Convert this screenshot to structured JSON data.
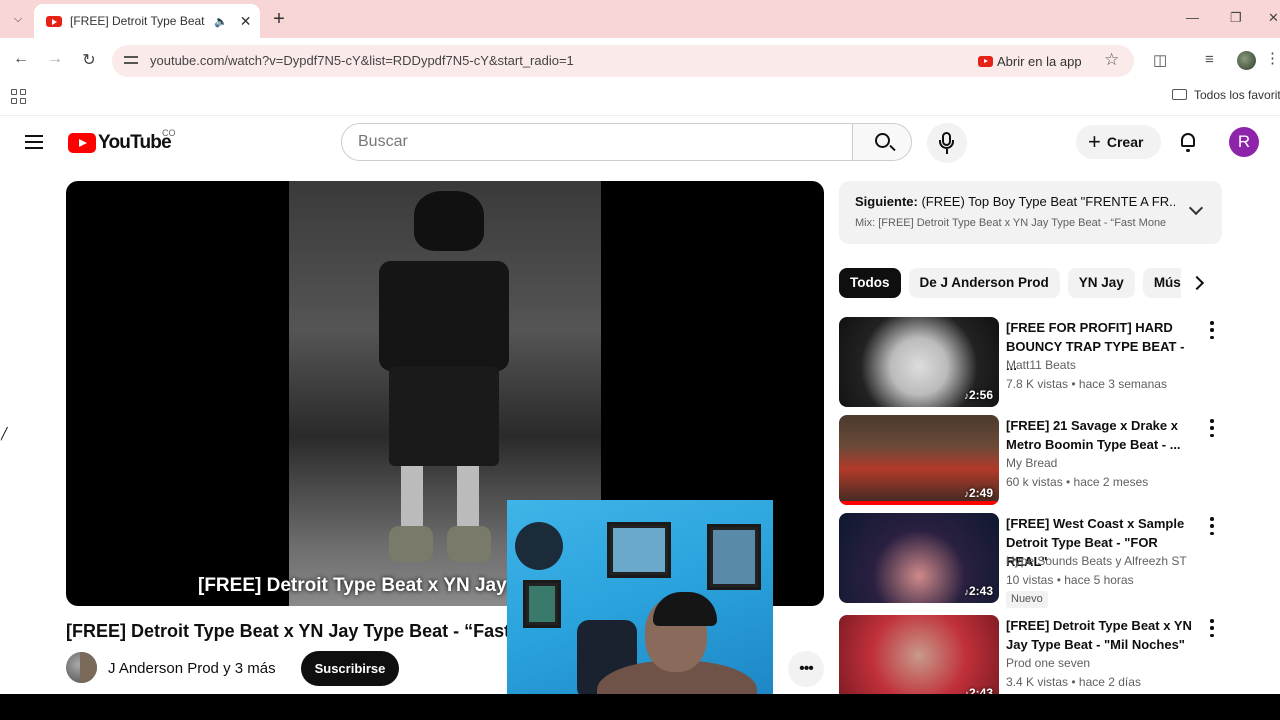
{
  "browser": {
    "tab_title": "[FREE] Detroit Type Beat x YN Jay",
    "url": "youtube.com/watch?v=Dypdf7N5-cY&list=RDDypdf7N5-cY&start_radio=1",
    "open_in_app_label": "Abrir en la app",
    "bookmarks_label": "Todos los favoritos"
  },
  "youtube": {
    "logo_text": "YouTube",
    "country_code": "CO",
    "search_placeholder": "Buscar",
    "create_label": "Crear",
    "avatar_letter": "R",
    "brand_color": "#ff0000",
    "avatar_color": "#8e24aa"
  },
  "video": {
    "caption_overlay": "[FREE] Detroit Type Beat x YN Jay Typ",
    "title": "[FREE] Detroit Type Beat x YN Jay Type Beat - “Fast",
    "channel": "J Anderson Prod y 3 más",
    "subscribe_label": "Suscribirse",
    "more_label": "•••"
  },
  "up_next": {
    "label": "Siguiente:",
    "next_title": "(FREE) Top Boy Type Beat \"FRENTE A FR...",
    "mix_title": "Mix: [FREE] Detroit Type Beat x YN Jay Type Beat - “Fast Mone"
  },
  "chips": [
    "Todos",
    "De J Anderson Prod",
    "YN Jay",
    "Músi"
  ],
  "recommendations": [
    {
      "title": "[FREE FOR PROFIT] HARD BOUNCY TRAP TYPE BEAT - ...",
      "channel": "Matt11 Beats",
      "meta": "7.8 K vistas • hace 3 semanas",
      "duration": "2:56",
      "badge": ""
    },
    {
      "title": "[FREE] 21 Savage x Drake x Metro Boomin Type Beat - ...",
      "channel": "My Bread",
      "meta": "60 k vistas • hace 2 meses",
      "duration": "2:49",
      "badge": "",
      "watched_fraction": 1.0
    },
    {
      "title": "[FREE] West Coast x Sample Detroit Type Beat - \"FOR REAL\"",
      "channel": "Hype Sounds Beats y Alfreezh ST",
      "meta": "10 vistas • hace 5 horas",
      "duration": "2:43",
      "badge": "Nuevo"
    },
    {
      "title": "[FREE] Detroit Type Beat x YN Jay Type Beat - \"Mil Noches\"",
      "channel": "Prod one seven",
      "meta": "3.4 K vistas • hace 2 días",
      "duration": "2:43",
      "badge": ""
    }
  ]
}
